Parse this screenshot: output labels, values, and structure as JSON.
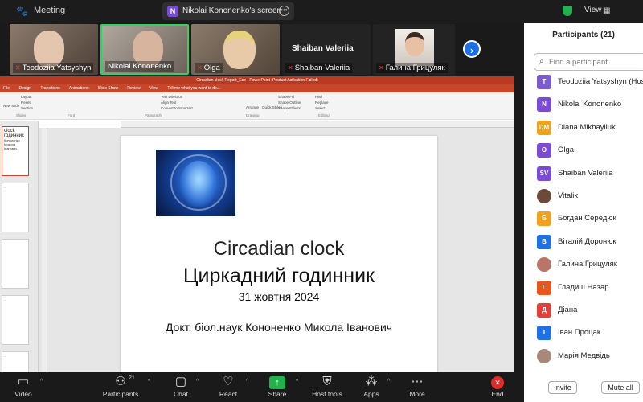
{
  "topbar": {
    "meeting_label": "Meeting",
    "share_badge": "N",
    "share_text": "Nikolai Kononenko's screen",
    "view_label": "View"
  },
  "gallery": {
    "tiles": [
      {
        "name": "Teodoziia Yatsyshyn",
        "color": "#6b5a4e"
      },
      {
        "name": "Nikolai Kononenko",
        "color": "#9a8e84"
      },
      {
        "name": "Olga",
        "color": "#7f6f60"
      },
      {
        "name": "Shaiban Valeriia",
        "color": "#2a2a2a"
      },
      {
        "name": "Галина Грицуляк",
        "color": "#c9c2ba"
      }
    ],
    "center_name": "Shaiban Valeriia"
  },
  "powerpoint": {
    "title_bar": "Circadian clock Report_Eco - PowerPoint (Product Activation Failed)",
    "tabs": [
      "File",
      "Design",
      "Transitions",
      "Animations",
      "Slide Show",
      "Review",
      "View",
      "Tell me what you want to do..."
    ],
    "ribbon_labels": {
      "new_slide": "New Slide",
      "layout": "Layout",
      "reset": "Reset",
      "section": "Section",
      "text_direction": "Text Direction",
      "align_text": "Align Text",
      "convert_smartart": "Convert to SmartArt",
      "arrange": "Arrange",
      "quick_styles": "Quick Styles",
      "shape_fill": "Shape Fill",
      "shape_outline": "Shape Outline",
      "shape_effects": "Shape Effects",
      "find": "Find",
      "replace": "Replace",
      "select": "Select"
    },
    "ribbon_groups": [
      "Slides",
      "Font",
      "Paragraph",
      "Drawing",
      "Editing"
    ],
    "thumbs": [
      {
        "big": "clock",
        "line2": "годинник",
        "line3": "Кононенко Микола Іванович"
      },
      {
        "big": "",
        "line2": "...",
        "line3": ""
      },
      {
        "big": "",
        "line2": "...",
        "line3": ""
      },
      {
        "big": "",
        "line2": "...",
        "line3": ""
      },
      {
        "big": "",
        "line2": "...",
        "line3": ""
      }
    ]
  },
  "slide": {
    "title_en": "Circadian clock",
    "title_ua": "Циркадний годинник",
    "date": "31 жовтня 2024",
    "author": "Докт. біол.наук Кононенко Микола Іванович"
  },
  "participants": {
    "title": "Participants (21)",
    "search_placeholder": "Find a participant",
    "list": [
      {
        "initials": "T",
        "name": "Teodoziia Yatsyshyn (Host, me)",
        "color": "#7b5cc9",
        "photo": false
      },
      {
        "initials": "N",
        "name": "Nikolai Kononenko",
        "color": "#7b4bd6",
        "photo": false
      },
      {
        "initials": "DM",
        "name": "Diana Mikhayliuk",
        "color": "#f0a21c",
        "photo": false
      },
      {
        "initials": "O",
        "name": "Olga",
        "color": "#7b4bd6",
        "photo": false
      },
      {
        "initials": "SV",
        "name": "Shaiban Valeriia",
        "color": "#7b4bd6",
        "photo": false
      },
      {
        "initials": "",
        "name": "Vitalik",
        "color": "#6b4a3a",
        "photo": true
      },
      {
        "initials": "Б",
        "name": "Богдан Середюк",
        "color": "#f0a21c",
        "photo": false
      },
      {
        "initials": "В",
        "name": "Віталій Доронюк",
        "color": "#1f6fe5",
        "photo": false
      },
      {
        "initials": "",
        "name": "Галина Грицуляк",
        "color": "#b8766a",
        "photo": true
      },
      {
        "initials": "Г",
        "name": "Гладиш Назар",
        "color": "#e8581c",
        "photo": false
      },
      {
        "initials": "Д",
        "name": "Діана",
        "color": "#e0413b",
        "photo": false
      },
      {
        "initials": "І",
        "name": "Іван Процак",
        "color": "#1f6fe5",
        "photo": false
      },
      {
        "initials": "",
        "name": "Марія Медвідь",
        "color": "#a88878",
        "photo": true
      }
    ],
    "invite_label": "Invite",
    "mute_all_label": "Mute all"
  },
  "toolbar": {
    "video": "Video",
    "participants": "Participants",
    "participants_count": "21",
    "chat": "Chat",
    "react": "React",
    "share": "Share",
    "host_tools": "Host tools",
    "apps": "Apps",
    "more": "More",
    "end": "End"
  }
}
